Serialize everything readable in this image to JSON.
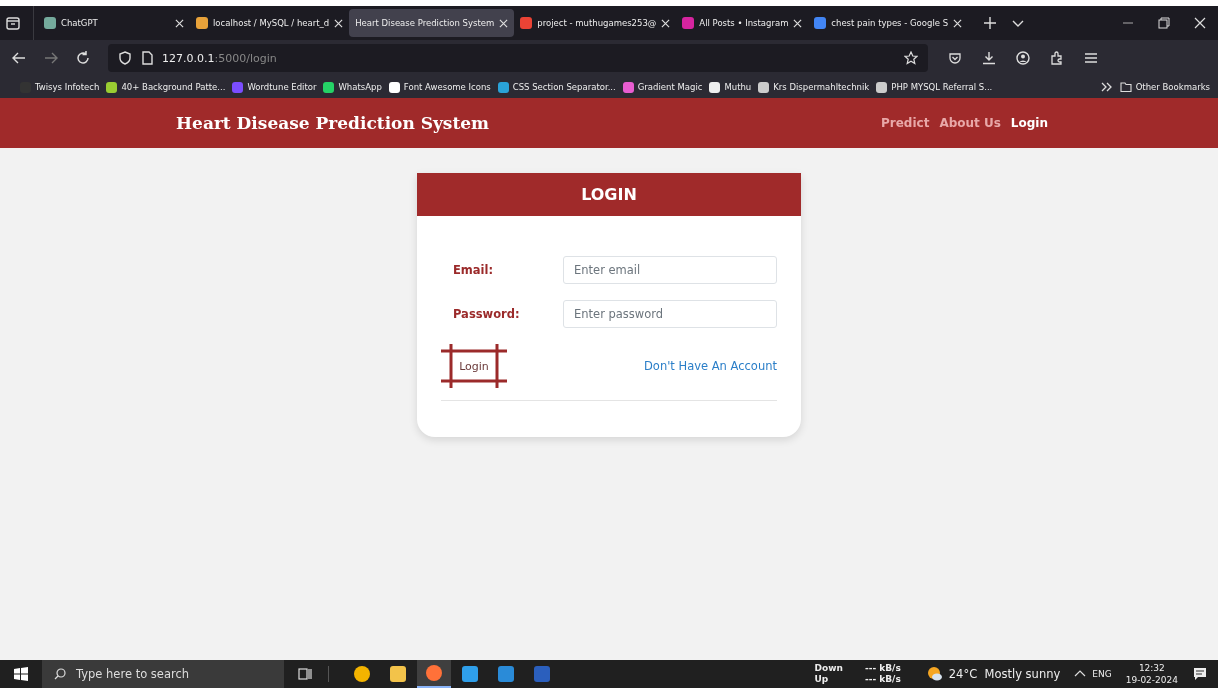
{
  "browser": {
    "tabs": [
      {
        "title": "ChatGPT",
        "selected": false
      },
      {
        "title": "localhost / MySQL / heart_d",
        "selected": false
      },
      {
        "title": "Heart Disease Prediction System",
        "selected": true
      },
      {
        "title": "project - muthugames253@",
        "selected": false
      },
      {
        "title": "All Posts • Instagram",
        "selected": false
      },
      {
        "title": "chest pain types - Google S",
        "selected": false
      }
    ],
    "address": {
      "host": "127.0.0.1",
      "path": ":5000/login"
    },
    "bookmarks": [
      "Twisys Infotech",
      "40+ Background Patte...",
      "Wordtune Editor",
      "WhatsApp",
      "Font Awesome Icons",
      "CSS Section Separator...",
      "Gradient Magic",
      "Muthu",
      "Krs Dispermahltechnik",
      "PHP MYSQL Referral S..."
    ],
    "other_bookmarks": "Other Bookmarks"
  },
  "site": {
    "brand": "Heart Disease Prediction System",
    "nav": [
      {
        "label": "Predict",
        "selected": false
      },
      {
        "label": "About Us",
        "selected": false
      },
      {
        "label": "Login",
        "selected": true
      }
    ],
    "login": {
      "title": "LOGIN",
      "email_label": "Email:",
      "email_placeholder": "Enter email",
      "password_label": "Password:",
      "password_placeholder": "Enter password",
      "button": "Login",
      "signup_link": "Don't Have An Account"
    }
  },
  "taskbar": {
    "search_placeholder": "Type here to search",
    "apps": [
      {
        "selected": false
      },
      {
        "selected": false
      },
      {
        "selected": true
      },
      {
        "selected": false
      },
      {
        "selected": false
      },
      {
        "selected": false
      }
    ],
    "net_down_label": "Down",
    "net_up_label": "Up",
    "net_down": "--- kB/s",
    "net_up": "--- kB/s",
    "weather": "24°C  Mostly sunny",
    "lang": "ENG",
    "time": "12:32",
    "date": "19-02-2024"
  }
}
